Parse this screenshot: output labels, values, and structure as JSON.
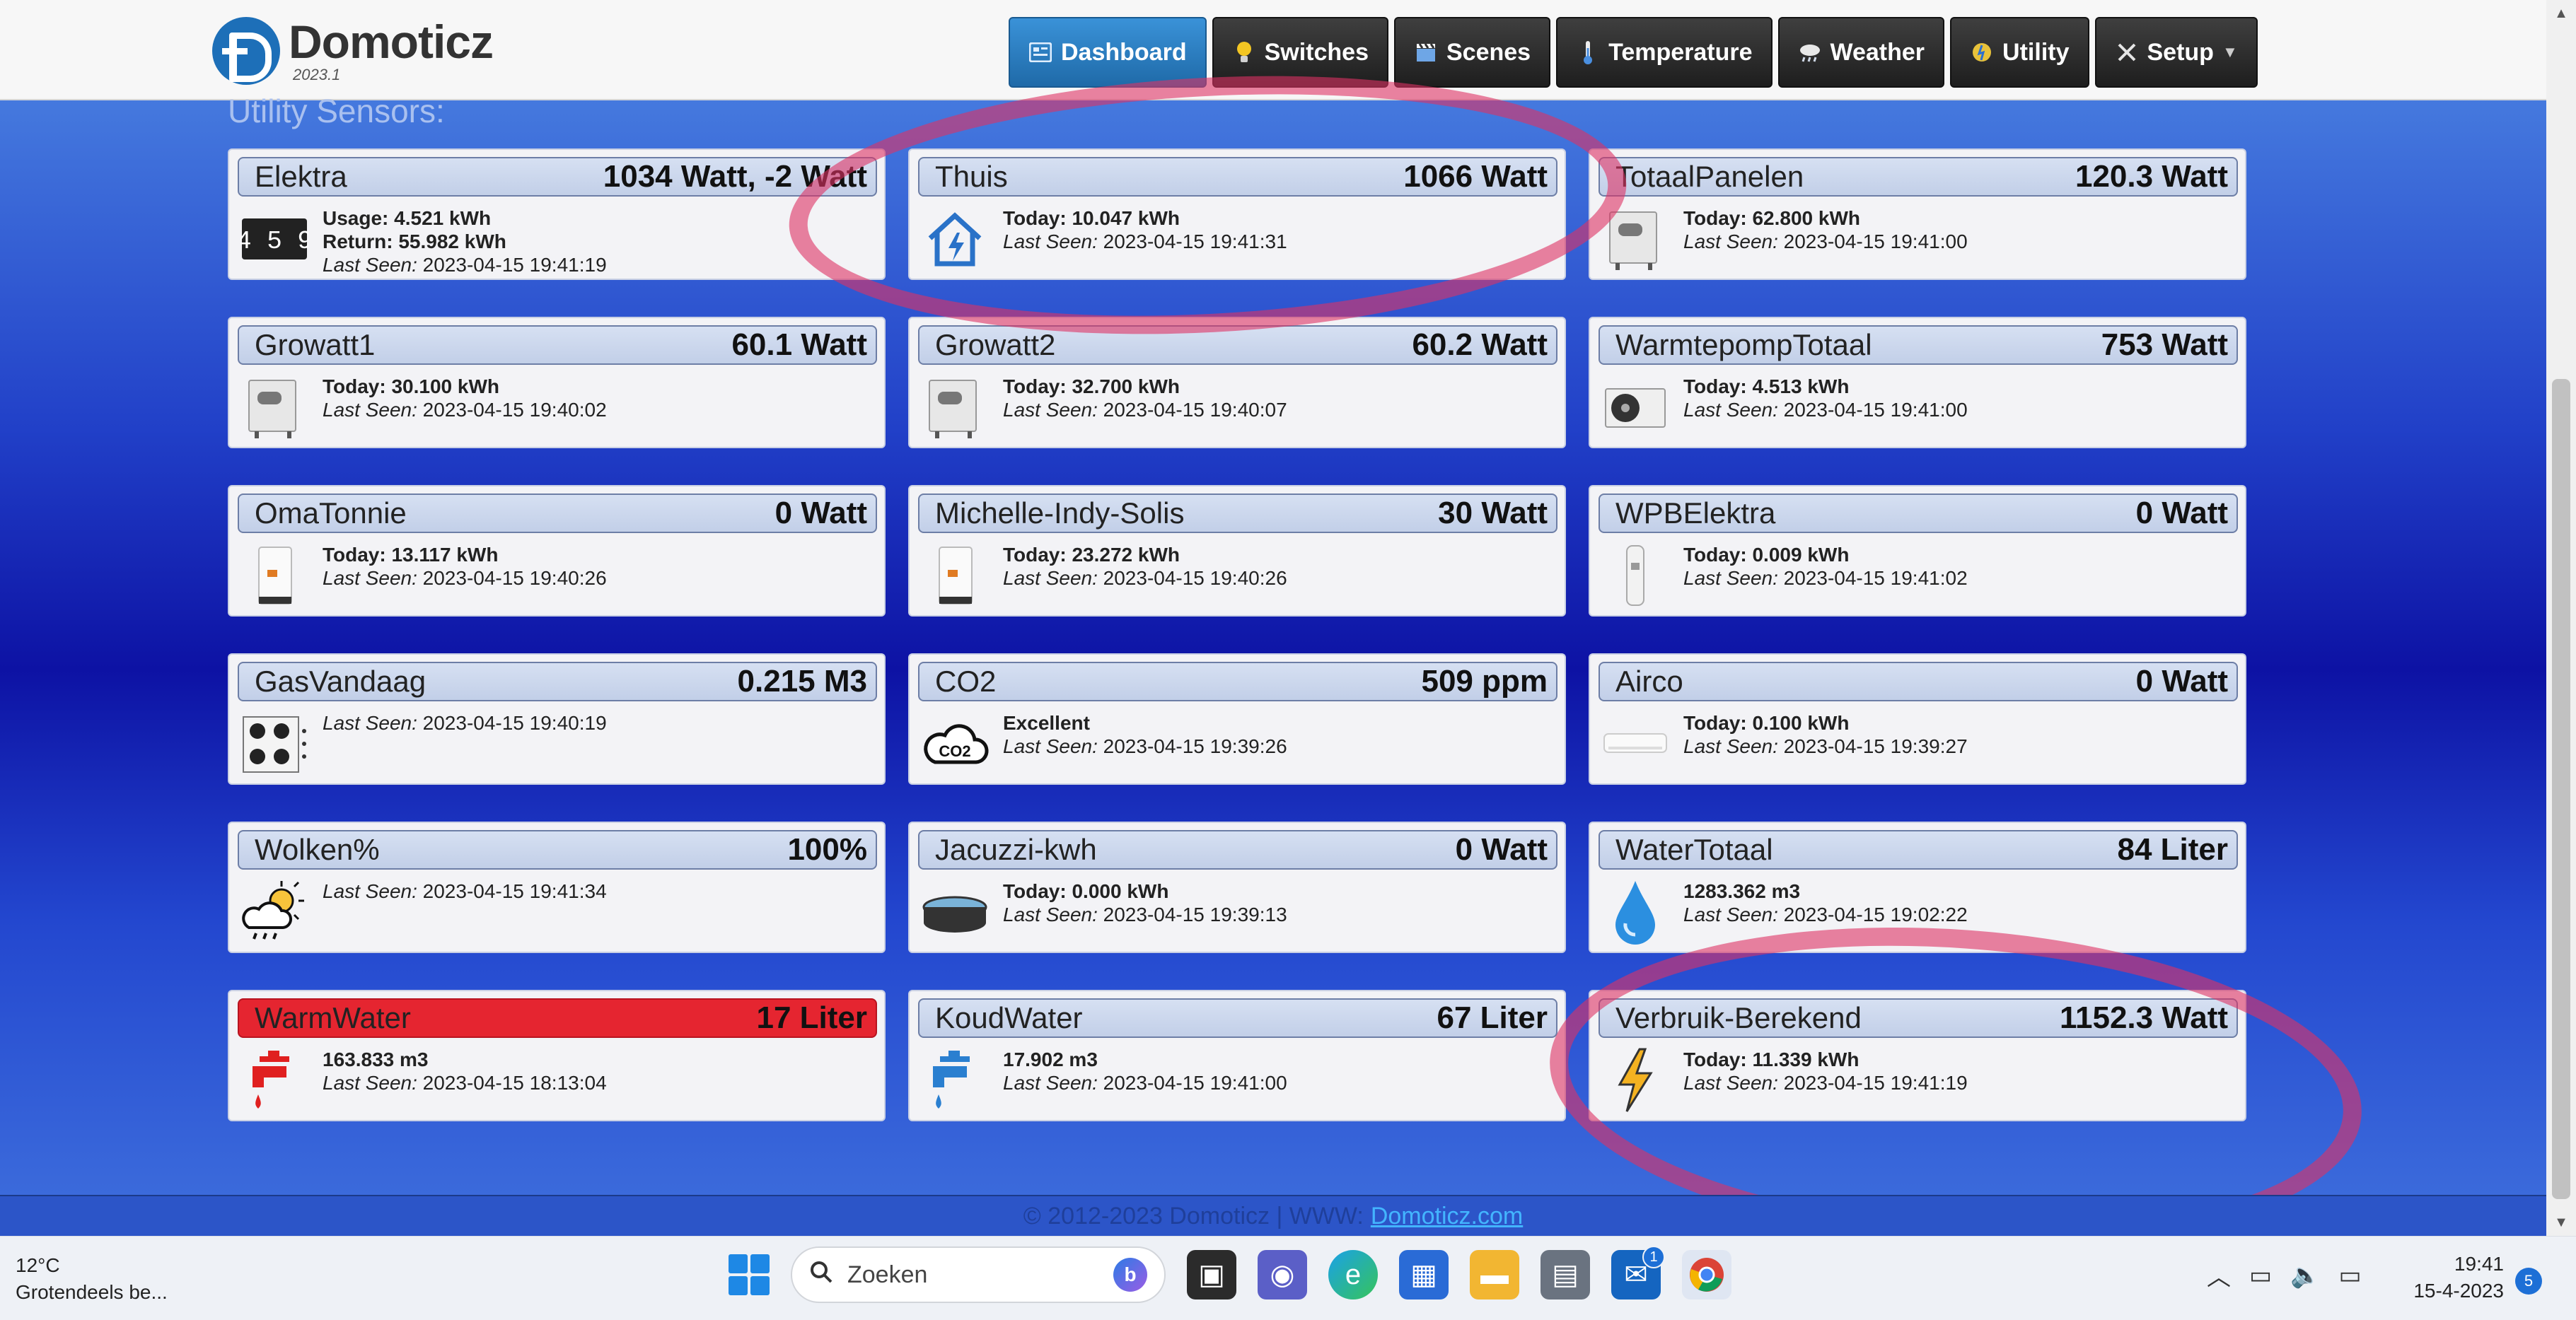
{
  "header": {
    "logo_name": "Domoticz",
    "logo_version": "2023.1",
    "nav": [
      {
        "label": "Dashboard",
        "icon": "dashboard-icon",
        "active": true
      },
      {
        "label": "Switches",
        "icon": "bulb-icon"
      },
      {
        "label": "Scenes",
        "icon": "clapper-icon"
      },
      {
        "label": "Temperature",
        "icon": "thermometer-icon"
      },
      {
        "label": "Weather",
        "icon": "cloud-rain-icon"
      },
      {
        "label": "Utility",
        "icon": "utility-icon"
      },
      {
        "label": "Setup",
        "icon": "tools-icon"
      }
    ]
  },
  "section_title": "Utility Sensors:",
  "cards": [
    {
      "name": "Elektra",
      "value": "1034 Watt, -2 Watt",
      "line1": "Usage: 4.521 kWh",
      "line2": "Return: 55.982 kWh",
      "last_seen": "2023-04-15 19:41:19",
      "icon": "meter-counter-icon",
      "counter_digits": "4 5 9"
    },
    {
      "name": "Thuis",
      "value": "1066 Watt",
      "line1": "Today: 10.047 kWh",
      "last_seen": "2023-04-15 19:41:31",
      "icon": "house-power-icon"
    },
    {
      "name": "TotaalPanelen",
      "value": "120.3 Watt",
      "line1": "Today: 62.800 kWh",
      "last_seen": "2023-04-15 19:41:00",
      "icon": "inverter-icon"
    },
    {
      "name": "Growatt1",
      "value": "60.1 Watt",
      "line1": "Today: 30.100 kWh",
      "last_seen": "2023-04-15 19:40:02",
      "icon": "inverter-icon"
    },
    {
      "name": "Growatt2",
      "value": "60.2 Watt",
      "line1": "Today: 32.700 kWh",
      "last_seen": "2023-04-15 19:40:07",
      "icon": "inverter-icon"
    },
    {
      "name": "WarmtepompTotaal",
      "value": "753 Watt",
      "line1": "Today: 4.513 kWh",
      "last_seen": "2023-04-15 19:41:00",
      "icon": "heat-pump-icon"
    },
    {
      "name": "OmaTonnie",
      "value": "0 Watt",
      "line1": "Today: 13.117 kWh",
      "last_seen": "2023-04-15 19:40:26",
      "icon": "inverter-white-icon"
    },
    {
      "name": "Michelle-Indy-Solis",
      "value": "30 Watt",
      "line1": "Today: 23.272 kWh",
      "last_seen": "2023-04-15 19:40:26",
      "icon": "inverter-white-icon"
    },
    {
      "name": "WPBElektra",
      "value": "0 Watt",
      "line1": "Today: 0.009 kWh",
      "last_seen": "2023-04-15 19:41:02",
      "icon": "boiler-icon"
    },
    {
      "name": "GasVandaag",
      "value": "0.215 M3",
      "last_seen": "2023-04-15 19:40:19",
      "icon": "gas-stove-icon"
    },
    {
      "name": "CO2",
      "value": "509 ppm",
      "line1": "Excellent",
      "last_seen": "2023-04-15 19:39:26",
      "icon": "co2-cloud-icon",
      "icon_text": "CO2"
    },
    {
      "name": "Airco",
      "value": "0 Watt",
      "line1": "Today: 0.100 kWh",
      "last_seen": "2023-04-15 19:39:27",
      "icon": "airco-icon"
    },
    {
      "name": "Wolken%",
      "value": "100%",
      "last_seen": "2023-04-15 19:41:34",
      "icon": "cloud-sun-rain-icon"
    },
    {
      "name": "Jacuzzi-kwh",
      "value": "0 Watt",
      "line1": "Today: 0.000 kWh",
      "last_seen": "2023-04-15 19:39:13",
      "icon": "jacuzzi-icon"
    },
    {
      "name": "WaterTotaal",
      "value": "84 Liter",
      "line1": "1283.362 m3",
      "last_seen": "2023-04-15 19:02:22",
      "icon": "water-drop-icon"
    },
    {
      "name": "WarmWater",
      "value": "17 Liter",
      "line1": "163.833 m3",
      "last_seen": "2023-04-15 18:13:04",
      "icon": "tap-red-icon",
      "alert": true
    },
    {
      "name": "KoudWater",
      "value": "67 Liter",
      "line1": "17.902 m3",
      "last_seen": "2023-04-15 19:41:00",
      "icon": "tap-blue-icon"
    },
    {
      "name": "Verbruik-Berekend",
      "value": "1152.3 Watt",
      "line1": "Today: 11.339 kWh",
      "last_seen": "2023-04-15 19:41:19",
      "icon": "lightning-icon"
    }
  ],
  "last_seen_label": "Last Seen:",
  "footer": {
    "text": "© 2012-2023 Domoticz | WWW:",
    "link": "Domoticz.com"
  },
  "taskbar": {
    "weather_temp": "12°C",
    "weather_desc": "Grotendeels be...",
    "search_placeholder": "Zoeken",
    "mail_badge": "1",
    "time": "19:41",
    "date": "15-4-2023",
    "notifications": "5"
  },
  "colors": {
    "accent": "#2c78c8",
    "alert": "#e52530",
    "highlight": "#de3264"
  }
}
